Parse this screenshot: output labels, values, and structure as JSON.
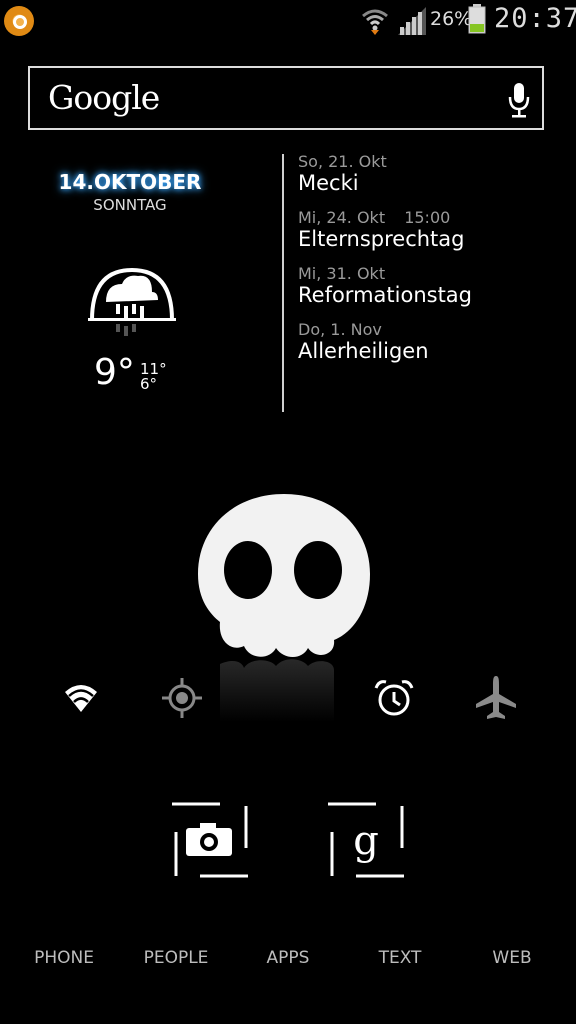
{
  "status_bar": {
    "battery_percent": "26%",
    "time": "20:37",
    "icons": [
      "notification-app-icon",
      "wifi-icon",
      "signal-icon",
      "battery-icon"
    ]
  },
  "search": {
    "logo_text": "Google",
    "icon": "mic-icon"
  },
  "clock_widget": {
    "date": "14.OKTOBER",
    "weekday": "SONNTAG",
    "weather_icon": "rain-cloud-icon",
    "temp_current": "9°",
    "temp_high": "11°",
    "temp_low": "6°",
    "accent_color": "#3aa7ff"
  },
  "calendar": {
    "events": [
      {
        "date": "So, 21. Okt",
        "time": "",
        "title": "Mecki"
      },
      {
        "date": "Mi, 24. Okt",
        "time": "15:00",
        "title": "Elternsprechtag"
      },
      {
        "date": "Mi, 31. Okt",
        "time": "",
        "title": "Reformationstag"
      },
      {
        "date": "Do, 1. Nov",
        "time": "",
        "title": "Allerheiligen"
      }
    ]
  },
  "toggles": [
    {
      "name": "wifi-toggle",
      "icon": "wifi-icon"
    },
    {
      "name": "gps-toggle",
      "icon": "gps-icon"
    },
    {
      "name": "alarm-toggle",
      "icon": "alarm-clock-icon"
    },
    {
      "name": "airplane-toggle",
      "icon": "airplane-icon"
    }
  ],
  "shortcuts": [
    {
      "name": "camera-shortcut",
      "icon": "camera-icon"
    },
    {
      "name": "google-shortcut",
      "icon": "google-g-icon",
      "glyph": "g"
    }
  ],
  "dock": {
    "items": [
      "PHONE",
      "PEOPLE",
      "APPS",
      "TEXT",
      "WEB"
    ]
  }
}
